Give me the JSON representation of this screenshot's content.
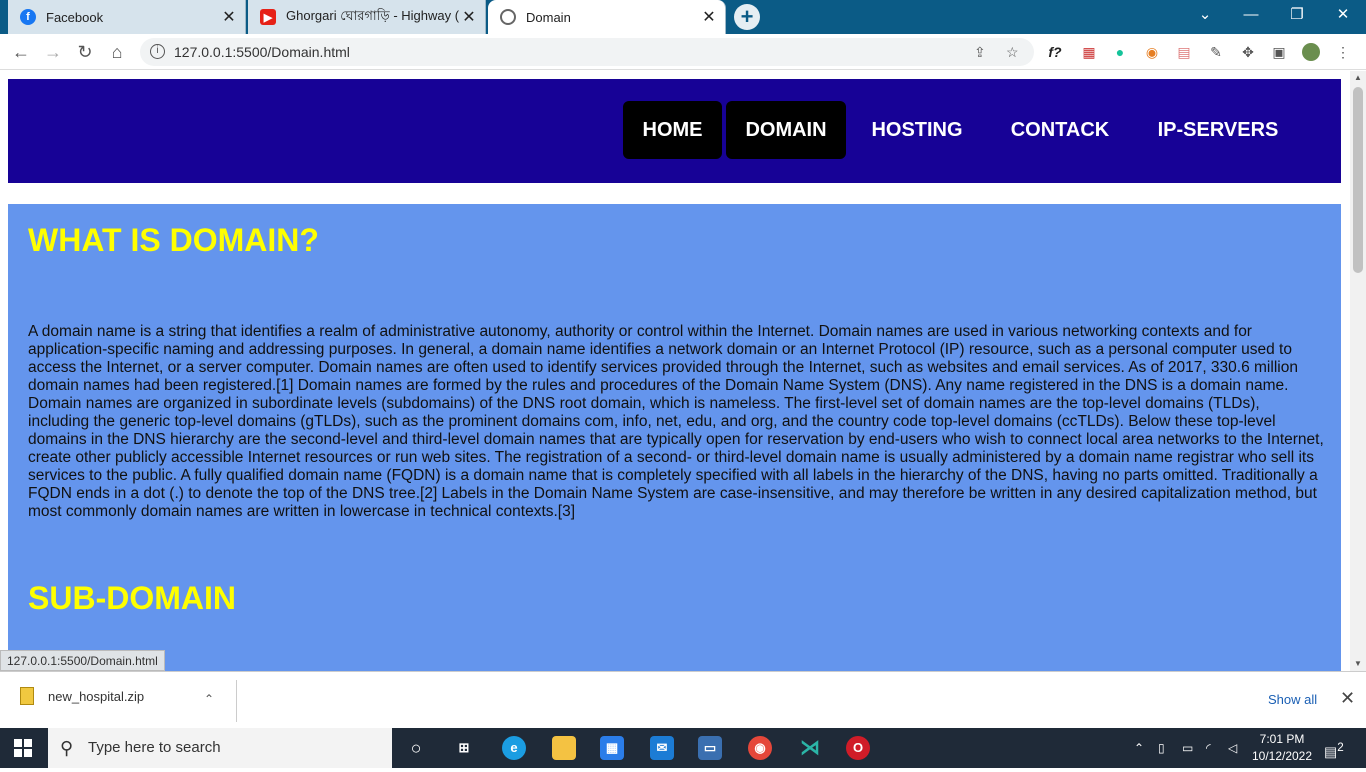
{
  "browser": {
    "tabs": [
      {
        "title": "Facebook",
        "icon": "facebook-icon"
      },
      {
        "title": "Ghorgari ঘোরগাড়ি - Highway (lyr",
        "icon": "youtube-icon"
      },
      {
        "title": "Domain",
        "icon": "globe-icon"
      }
    ],
    "new_tab_label": "+",
    "url": "127.0.0.1:5500/Domain.html",
    "status_url": "127.0.0.1:5500/Domain.html"
  },
  "site": {
    "nav": [
      "HOME",
      "DOMAIN",
      "HOSTING",
      "CONTACK",
      "IP-SERVERS"
    ],
    "heading": "WHAT IS DOMAIN?",
    "paragraph": "A domain name is a string that identifies a realm of administrative autonomy, authority or control within the Internet. Domain names are used in various networking contexts and for application-specific naming and addressing purposes. In general, a domain name identifies a network domain or an Internet Protocol (IP) resource, such as a personal computer used to access the Internet, or a server computer. Domain names are often used to identify services provided through the Internet, such as websites and email services. As of 2017, 330.6 million domain names had been registered.[1] Domain names are formed by the rules and procedures of the Domain Name System (DNS). Any name registered in the DNS is a domain name. Domain names are organized in subordinate levels (subdomains) of the DNS root domain, which is nameless. The first-level set of domain names are the top-level domains (TLDs), including the generic top-level domains (gTLDs), such as the prominent domains com, info, net, edu, and org, and the country code top-level domains (ccTLDs). Below these top-level domains in the DNS hierarchy are the second-level and third-level domain names that are typically open for reservation by end-users who wish to connect local area networks to the Internet, create other publicly accessible Internet resources or run web sites. The registration of a second- or third-level domain name is usually administered by a domain name registrar who sell its services to the public. A fully qualified domain name (FQDN) is a domain name that is completely specified with all labels in the hierarchy of the DNS, having no parts omitted. Traditionally a FQDN ends in a dot (.) to denote the top of the DNS tree.[2] Labels in the Domain Name System are case-insensitive, and may therefore be written in any desired capitalization method, but most commonly domain names are written in lowercase in technical contexts.[3]",
    "subheading": "SUB-DOMAIN",
    "colors": {
      "navbar": "#170296",
      "content_bg": "#6495ed",
      "heading": "#ffff00"
    }
  },
  "downloads": {
    "file": "new_hospital.zip",
    "show_all": "Show all"
  },
  "taskbar": {
    "search_placeholder": "Type here to search",
    "time": "7:01 PM",
    "date": "10/12/2022",
    "notifications": "2"
  }
}
